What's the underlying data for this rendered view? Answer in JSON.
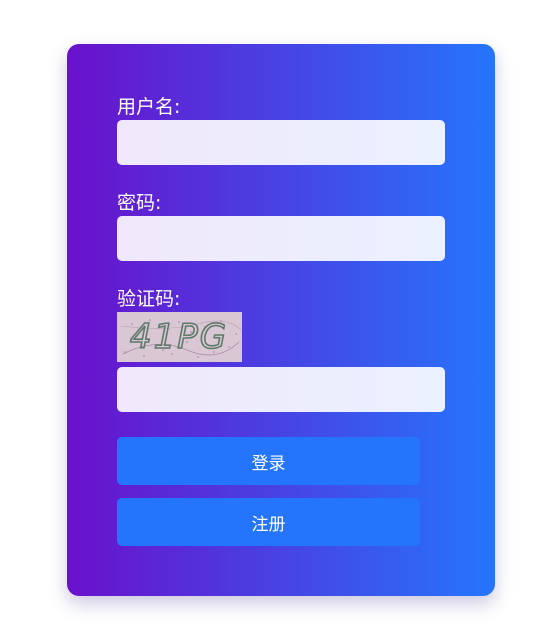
{
  "form": {
    "username_label": "用户名:",
    "username_value": "",
    "password_label": "密码:",
    "password_value": "",
    "captcha_label": "验证码:",
    "captcha_text": "41PG",
    "captcha_value": "",
    "login_label": "登录",
    "register_label": "注册"
  },
  "colors": {
    "gradient_start": "#6a11cb",
    "gradient_end": "#2575fc",
    "button": "#2575fc",
    "captcha_bg": "#d9c7d3",
    "captcha_text": "#5f7a6a"
  }
}
